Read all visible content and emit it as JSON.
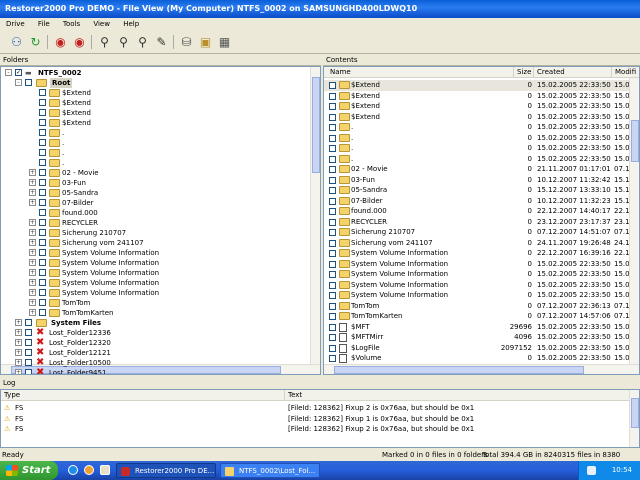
{
  "window": {
    "title": "Restorer2000 Pro DEMO - File View (My Computer) NTFS_0002 on SAMSUNGHD400LDWQ10"
  },
  "menu": [
    "Drive",
    "File",
    "Tools",
    "View",
    "Help"
  ],
  "toolbar": {
    "icons": [
      "connect-icon",
      "refresh-icon",
      "scan-icon",
      "search-drive-icon",
      "find-icon",
      "find-next-icon",
      "zoom-icon",
      "mark-icon",
      "recover-icon",
      "save-icon",
      "export-icon",
      "settings-icon"
    ]
  },
  "folders": {
    "header": "Folders",
    "root_drive": "NTFS_0002",
    "root": "Root",
    "items": [
      "$Extend",
      "$Extend",
      "$Extend",
      "$Extend",
      ".",
      ".",
      ".",
      ".",
      "02 - Movie",
      "03-Fun",
      "05-Sandra",
      "07-Bilder",
      "found.000",
      "RECYCLER",
      "Sicherung 210707",
      "Sicherung vom 241107",
      "System Volume Information",
      "System Volume Information",
      "System Volume Information",
      "System Volume Information",
      "System Volume Information",
      "TomTom",
      "TomTomKarten"
    ],
    "system_files": "System Files",
    "lost": [
      "Lost_Folder12336",
      "Lost_Folder12320",
      "Lost_Folder12121",
      "Lost_Folder10500",
      "Lost_Folder9451"
    ]
  },
  "contents": {
    "header": "Contents",
    "columns": {
      "name": "Name",
      "size": "Size",
      "created": "Created",
      "modified": "Modifi"
    },
    "rows": [
      {
        "name": "$Extend",
        "size": "0",
        "created": "15.02.2005 22:33:50",
        "modified": "15.02."
      },
      {
        "name": "$Extend",
        "size": "0",
        "created": "15.02.2005 22:33:50",
        "modified": "15.02."
      },
      {
        "name": "$Extend",
        "size": "0",
        "created": "15.02.2005 22:33:50",
        "modified": "15.02."
      },
      {
        "name": "$Extend",
        "size": "0",
        "created": "15.02.2005 22:33:50",
        "modified": "15.02."
      },
      {
        "name": ".",
        "size": "0",
        "created": "15.02.2005 22:33:50",
        "modified": "15.02."
      },
      {
        "name": ".",
        "size": "0",
        "created": "15.02.2005 22:33:50",
        "modified": "15.02."
      },
      {
        "name": ".",
        "size": "0",
        "created": "15.02.2005 22:33:50",
        "modified": "15.02."
      },
      {
        "name": ".",
        "size": "0",
        "created": "15.02.2005 22:33:50",
        "modified": "15.02."
      },
      {
        "name": "02 - Movie",
        "size": "0",
        "created": "21.11.2007 01:17:01",
        "modified": "07.12."
      },
      {
        "name": "03-Fun",
        "size": "0",
        "created": "10.12.2007 11:32:42",
        "modified": "15.12."
      },
      {
        "name": "05-Sandra",
        "size": "0",
        "created": "15.12.2007 13:33:10",
        "modified": "15.12."
      },
      {
        "name": "07-Bilder",
        "size": "0",
        "created": "10.12.2007 11:32:23",
        "modified": "15.12."
      },
      {
        "name": "found.000",
        "size": "0",
        "created": "22.12.2007 14:40:17",
        "modified": "22.12."
      },
      {
        "name": "RECYCLER",
        "size": "0",
        "created": "23.12.2007 23:17:37",
        "modified": "23.12."
      },
      {
        "name": "Sicherung 210707",
        "size": "0",
        "created": "07.12.2007 14:51:07",
        "modified": "07.12."
      },
      {
        "name": "Sicherung vom 241107",
        "size": "0",
        "created": "24.11.2007 19:26:48",
        "modified": "24.11."
      },
      {
        "name": "System Volume Information",
        "size": "0",
        "created": "22.12.2007 16:39:16",
        "modified": "22.12."
      },
      {
        "name": "System Volume Information",
        "size": "0",
        "created": "15.02.2005 22:33:50",
        "modified": "15.02."
      },
      {
        "name": "System Volume Information",
        "size": "0",
        "created": "15.02.2005 22:33:50",
        "modified": "15.02."
      },
      {
        "name": "System Volume Information",
        "size": "0",
        "created": "15.02.2005 22:33:50",
        "modified": "15.02."
      },
      {
        "name": "System Volume Information",
        "size": "0",
        "created": "15.02.2005 22:33:50",
        "modified": "15.02."
      },
      {
        "name": "TomTom",
        "size": "0",
        "created": "07.12.2007 22:36:13",
        "modified": "07.12."
      },
      {
        "name": "TomTomKarten",
        "size": "0",
        "created": "07.12.2007 14:57:06",
        "modified": "07.12."
      },
      {
        "name": "$MFT",
        "size": "29696",
        "created": "15.02.2005 22:33:50",
        "modified": "15.02."
      },
      {
        "name": "$MFTMirr",
        "size": "4096",
        "created": "15.02.2005 22:33:50",
        "modified": "15.02."
      },
      {
        "name": "$LogFile",
        "size": "2097152",
        "created": "15.02.2005 22:33:50",
        "modified": "15.02."
      },
      {
        "name": "$Volume",
        "size": "0",
        "created": "15.02.2005 22:33:50",
        "modified": "15.02."
      }
    ]
  },
  "log": {
    "header": "Log",
    "columns": {
      "type": "Type",
      "text": "Text"
    },
    "rows": [
      {
        "type": "FS",
        "text": "[FileId: 128362] Fixup 2 is 0x76aa, but should be 0x1"
      },
      {
        "type": "FS",
        "text": "[FileId: 128362] Fixup 1 is 0x76aa, but should be 0x1"
      },
      {
        "type": "FS",
        "text": "[FileId: 128362] Fixup 2 is 0x76aa, but should be 0x1"
      }
    ]
  },
  "status": {
    "ready": "Ready",
    "marked": "Marked 0 in 0 files in 0 folders",
    "total": "Total 394.4 GB in 8240315 files in 8380 folders"
  },
  "taskbar": {
    "start": "Start",
    "tasks": [
      "Restorer2000 Pro DE...",
      "NTFS_0002\\Lost_Fol..."
    ],
    "clock": "10:54"
  }
}
